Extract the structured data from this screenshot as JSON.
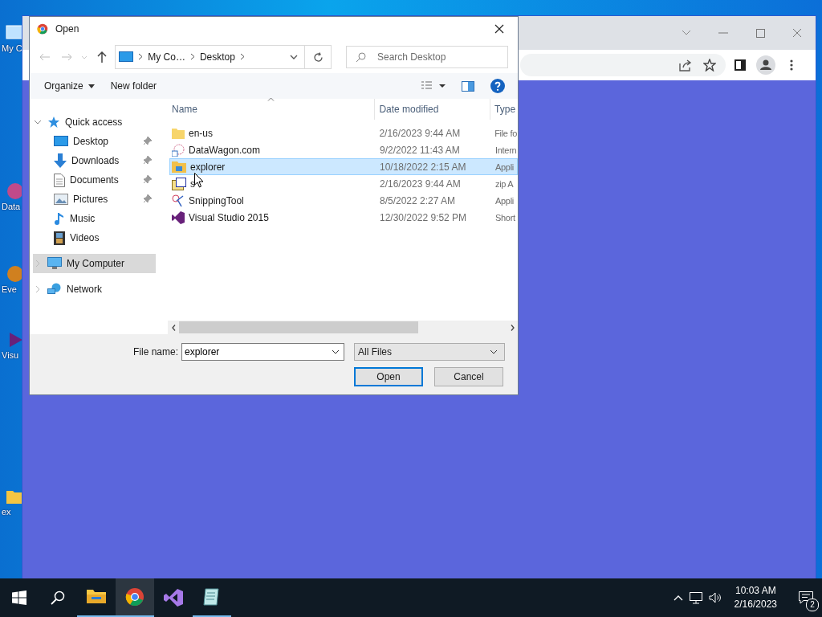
{
  "desktop_icons": [
    {
      "label": "My C"
    },
    {
      "label": "Data"
    },
    {
      "label": "Eve"
    },
    {
      "label": "Visu"
    },
    {
      "label": "ex"
    }
  ],
  "dialog": {
    "title": "Open",
    "breadcrumb": [
      "My Co…",
      "Desktop"
    ],
    "search": {
      "placeholder": "Search Desktop"
    },
    "toolbar": [
      "Organize",
      "New folder"
    ],
    "nav": [
      {
        "label": "Quick access",
        "expanded": true,
        "selected": false,
        "children": [
          {
            "label": "Desktop",
            "pinned": true,
            "selected": false
          },
          {
            "label": "Downloads",
            "pinned": true,
            "selected": false
          },
          {
            "label": "Documents",
            "pinned": true,
            "selected": false
          },
          {
            "label": "Pictures",
            "pinned": true,
            "selected": false
          },
          {
            "label": "Music",
            "pinned": false,
            "selected": false
          },
          {
            "label": "Videos",
            "pinned": false,
            "selected": false
          }
        ]
      },
      {
        "label": "My Computer",
        "expanded": false,
        "selected": true
      },
      {
        "label": "Network",
        "expanded": false,
        "selected": false
      }
    ],
    "columns": [
      "Name",
      "Date modified",
      "Type"
    ],
    "rows": [
      {
        "name": "en-us",
        "date": "2/16/2023 9:44 AM",
        "type": "File fo",
        "selected": false
      },
      {
        "name": "DataWagon.com",
        "date": "9/2/2022 11:43 AM",
        "type": "Intern",
        "selected": false
      },
      {
        "name": "explorer",
        "date": "10/18/2022 2:15 AM",
        "type": "Appli",
        "selected": true
      },
      {
        "name": "s",
        "date": "2/16/2023 9:44 AM",
        "type": "zip A",
        "selected": false
      },
      {
        "name": "SnippingTool",
        "date": "8/5/2022 2:27 AM",
        "type": "Appli",
        "selected": false
      },
      {
        "name": "Visual Studio 2015",
        "date": "12/30/2022 9:52 PM",
        "type": "Short",
        "selected": false
      }
    ],
    "file_name": {
      "label": "File name:",
      "value": "explorer"
    },
    "file_type": "All Files",
    "buttons": [
      {
        "label": "Open",
        "default": true
      },
      {
        "label": "Cancel",
        "default": false
      }
    ]
  },
  "taskbar": {
    "apps": [
      {
        "running": true,
        "selected": false
      },
      {
        "running": true,
        "selected": true
      },
      {
        "running": false,
        "selected": false
      },
      {
        "running": true,
        "selected": false
      }
    ],
    "time": "10:03 AM",
    "date": "2/16/2023",
    "notifications": "2"
  }
}
